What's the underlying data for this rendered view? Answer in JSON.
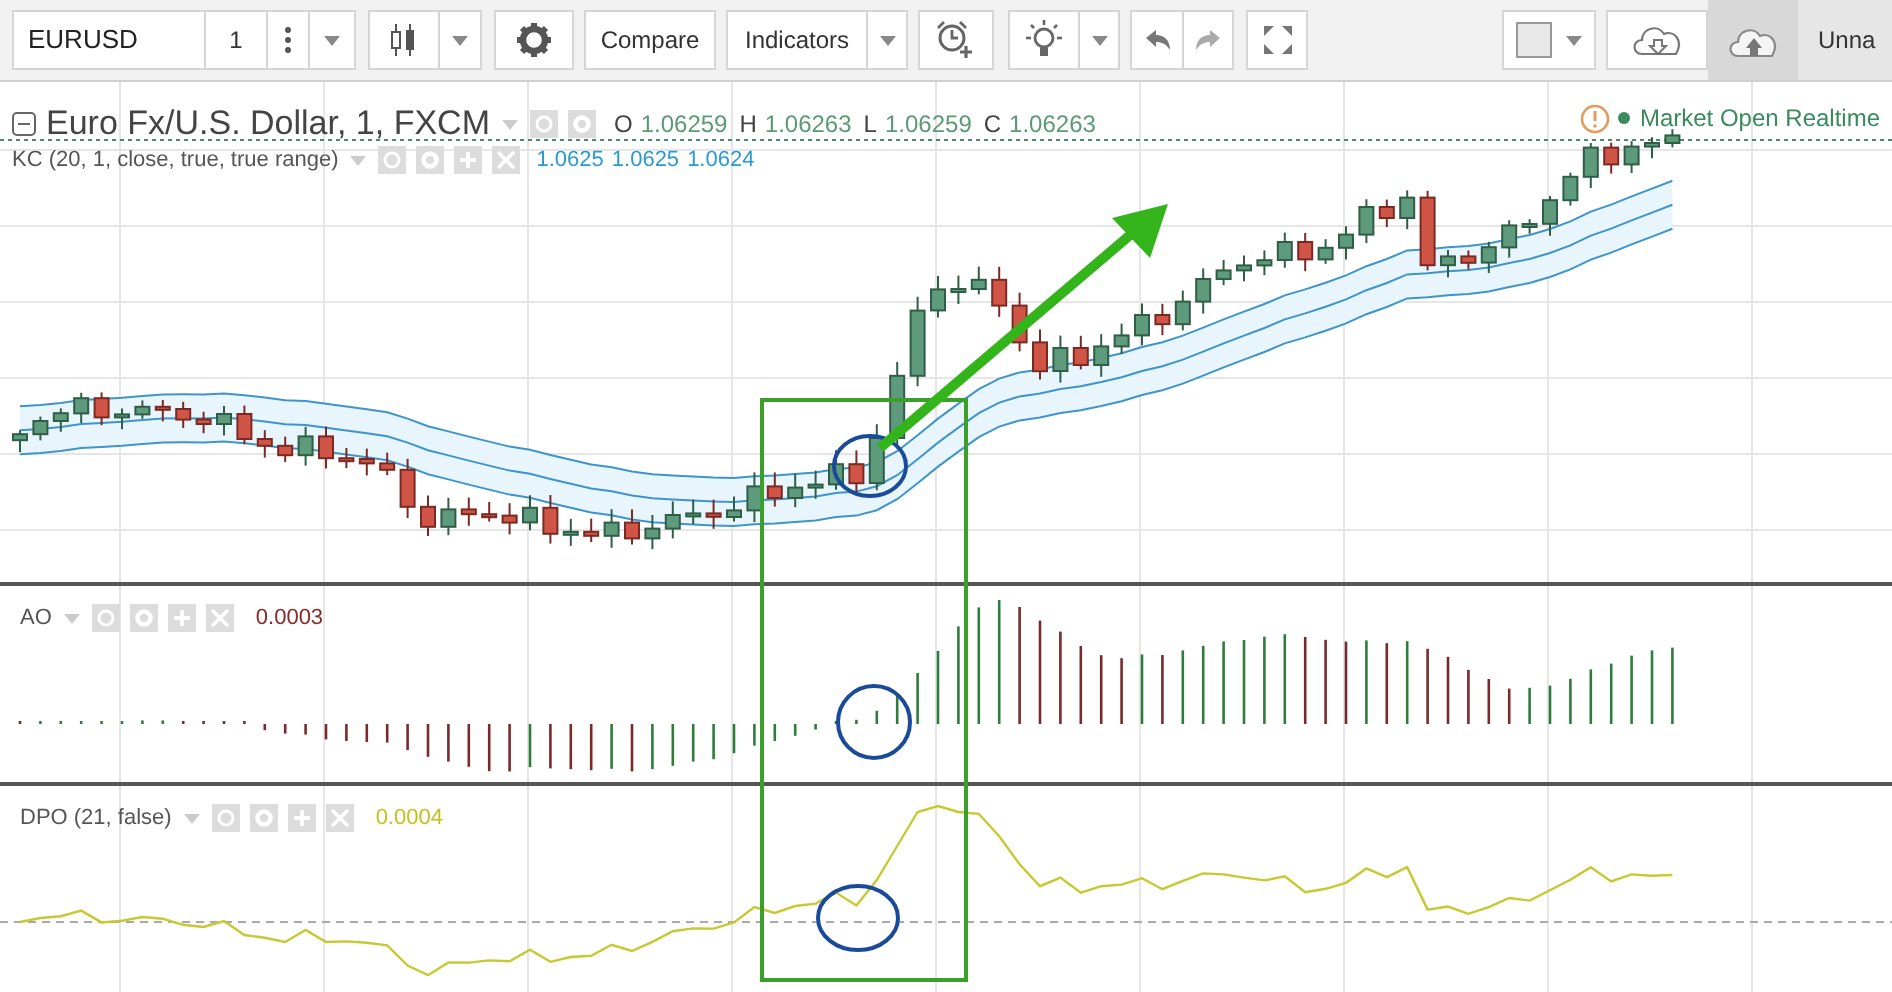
{
  "toolbar": {
    "symbol": "EURUSD",
    "interval": "1",
    "compare_label": "Compare",
    "indicators_label": "Indicators",
    "layout_name": "Unna"
  },
  "main_pane": {
    "title": "Euro Fx/U.S. Dollar, 1, FXCM",
    "ohlc": [
      {
        "key": "O",
        "value": "1.06259"
      },
      {
        "key": "H",
        "value": "1.06263"
      },
      {
        "key": "L",
        "value": "1.06259"
      },
      {
        "key": "C",
        "value": "1.06263"
      }
    ],
    "status": "Market Open Realtime",
    "study": {
      "label": "KC (20, 1, close, true, true range)",
      "values": [
        "1.0625",
        "1.0625",
        "1.0624"
      ]
    }
  },
  "panes": [
    {
      "kind": "ao",
      "label": "AO",
      "value": "0.0003"
    },
    {
      "kind": "dpo",
      "label": "DPO (21, false)",
      "value": "0.0004"
    }
  ]
}
